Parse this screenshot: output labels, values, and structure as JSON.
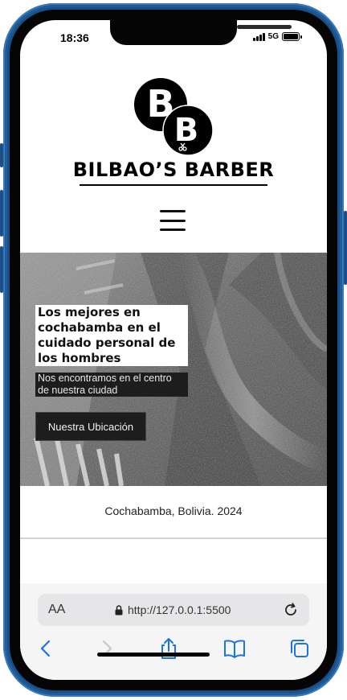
{
  "status_bar": {
    "time": "18:36",
    "network": "5G",
    "icons": [
      "signal-icon",
      "battery-icon"
    ]
  },
  "header": {
    "logo_letters": [
      "B",
      "B"
    ],
    "brand_name": "BILBAO’S BARBER",
    "menu_icon": "hamburger-menu-icon"
  },
  "hero": {
    "title": "Los mejores en cochabamba en el cuidado personal de los hombres",
    "subtitle": "Nos encontramos en el centro de nuestra ciudad",
    "button_label": "Nuestra Ubicación"
  },
  "footer": {
    "text": "Cochabamba, Bolivia. 2024"
  },
  "browser": {
    "aa_label": "AA",
    "url": "http://127.0.0.1:5500",
    "icons": [
      "lock-icon",
      "reload-icon",
      "back-icon",
      "forward-icon",
      "share-icon",
      "bookmarks-icon",
      "tabs-icon"
    ]
  },
  "colors": {
    "frame": "#1b4f86",
    "accent": "#1a73e8",
    "hero_text_bg": "#1d1d1d"
  }
}
